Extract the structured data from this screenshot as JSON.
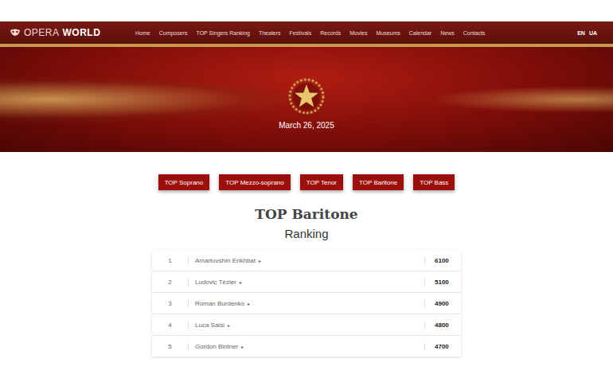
{
  "window": {
    "title": "Opera World"
  },
  "logo": {
    "first": "OPERA",
    "second": "WORLD"
  },
  "nav": {
    "items": [
      "Home",
      "Composers",
      "TOP Singers Ranking",
      "Theaters",
      "Festivals",
      "Records",
      "Movies",
      "Museums",
      "Calendar",
      "News",
      "Contacts"
    ],
    "languages": [
      "EN",
      "UA"
    ]
  },
  "hero": {
    "date": "March 26, 2025"
  },
  "voice_tabs": [
    "TOP Soprano",
    "TOP Mezzo-soprano",
    "TOP Tenor",
    "TOP Baritone",
    "TOP Bass"
  ],
  "heading": {
    "title": "TOP Baritone",
    "subtitle": "Ranking"
  },
  "ranking": {
    "row_marker": "▸",
    "rows": [
      {
        "rank": "1",
        "name": "Amartuvshin Enkhbat",
        "score": "6100"
      },
      {
        "rank": "2",
        "name": "Ludovic Tézier",
        "score": "5100"
      },
      {
        "rank": "3",
        "name": "Roman Burdenko",
        "score": "4900"
      },
      {
        "rank": "4",
        "name": "Luca Salsi",
        "score": "4800"
      },
      {
        "rank": "5",
        "name": "Gordon Bintner",
        "score": "4700"
      }
    ]
  }
}
